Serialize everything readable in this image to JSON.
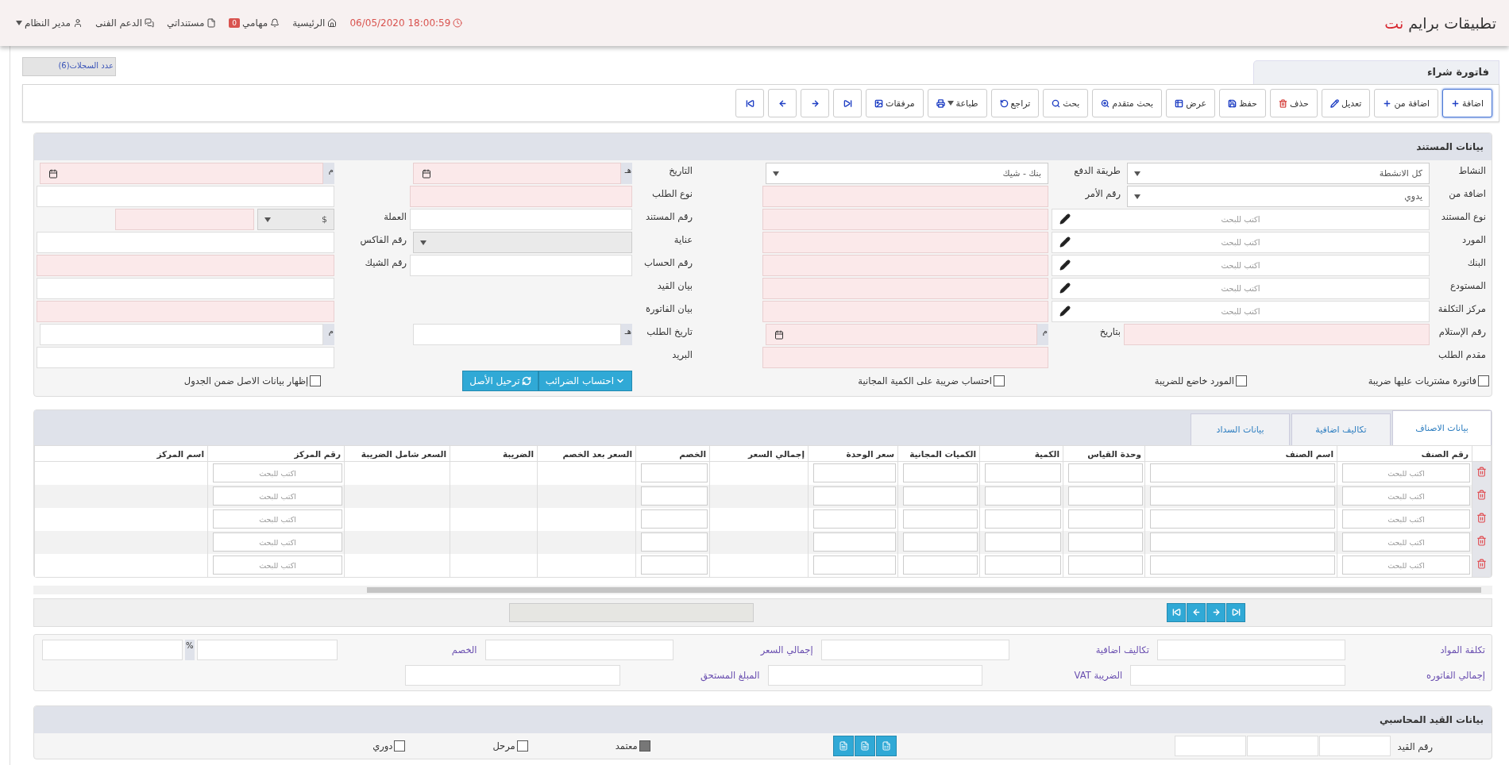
{
  "app": {
    "brand": "تطبيقات برايم",
    "brand_accent": "نت"
  },
  "top_nav": [
    {
      "kind": "clock",
      "label": "18:00:59 06/05/2020"
    },
    {
      "kind": "home",
      "label": "الرئيسية"
    },
    {
      "kind": "tasks",
      "label": "مهامي",
      "badge": "0"
    },
    {
      "kind": "docs",
      "label": "مستنداتي"
    },
    {
      "kind": "support",
      "label": "الدعم الفنى"
    },
    {
      "kind": "user",
      "label": "مدير النظام"
    }
  ],
  "page_title": "فاتورة شراء",
  "records_count": "عدد السجلات(6)",
  "toolbar": [
    {
      "kind": "add",
      "label": "اضافة",
      "selected": true
    },
    {
      "kind": "add_from",
      "label": "اضافة من",
      "selected": false
    },
    {
      "kind": "edit",
      "label": "تعديل",
      "selected": false
    },
    {
      "kind": "delete",
      "label": "حذف",
      "selected": false
    },
    {
      "kind": "save",
      "label": "حفظ",
      "selected": false
    },
    {
      "kind": "view",
      "label": "عرض",
      "selected": false
    },
    {
      "kind": "advanced_search",
      "label": "بحث متقدم",
      "selected": false
    },
    {
      "kind": "search",
      "label": "بحث",
      "selected": false
    },
    {
      "kind": "undo",
      "label": "تراجع",
      "selected": false
    },
    {
      "kind": "print",
      "label": "طباعة",
      "selected": false
    },
    {
      "kind": "attachments",
      "label": "مرفقات",
      "selected": false
    },
    {
      "kind": "last",
      "selected": false
    },
    {
      "kind": "next",
      "selected": false
    },
    {
      "kind": "prev",
      "selected": false
    },
    {
      "kind": "first",
      "selected": false
    }
  ],
  "document": {
    "title": "بيانات المستند",
    "right_rows": [
      {
        "cells": [
          {
            "kind": "label",
            "text": "النشاط"
          },
          {
            "kind": "select",
            "value": "كل الانشطة",
            "highlighted": false
          },
          {
            "kind": "label",
            "text": "طريقة الدفع"
          },
          {
            "kind": "select",
            "value": "بنك - شيك",
            "highlighted": false
          }
        ]
      },
      {
        "cells": [
          {
            "kind": "label",
            "text": "اضافة من"
          },
          {
            "kind": "select",
            "value": "يدوي",
            "highlighted": false
          },
          {
            "kind": "label",
            "text": "رقم الأمر"
          },
          {
            "kind": "input",
            "highlighted": true
          }
        ]
      },
      {
        "cells": [
          {
            "kind": "label",
            "text": "نوع المستند"
          },
          {
            "kind": "lookup",
            "placeholder": "اكتب للبحث",
            "highlighted": false
          },
          {
            "kind": "input",
            "highlighted": true
          }
        ]
      },
      {
        "cells": [
          {
            "kind": "label",
            "text": "المورد"
          },
          {
            "kind": "lookup",
            "placeholder": "اكتب للبحث",
            "highlighted": false
          },
          {
            "kind": "input",
            "highlighted": true
          }
        ]
      },
      {
        "cells": [
          {
            "kind": "label",
            "text": "البنك"
          },
          {
            "kind": "lookup",
            "placeholder": "اكتب للبحث",
            "highlighted": false
          },
          {
            "kind": "input",
            "highlighted": true
          }
        ]
      },
      {
        "cells": [
          {
            "kind": "label",
            "text": "المستودع"
          },
          {
            "kind": "lookup",
            "placeholder": "اكتب للبحث",
            "highlighted": false
          },
          {
            "kind": "input",
            "highlighted": true
          }
        ]
      },
      {
        "cells": [
          {
            "kind": "label",
            "text": "مركز التكلفة"
          },
          {
            "kind": "lookup",
            "placeholder": "اكتب للبحث",
            "highlighted": false
          },
          {
            "kind": "input",
            "highlighted": true
          }
        ]
      },
      {
        "cells": [
          {
            "kind": "label",
            "text": "رقم الإستلام"
          },
          {
            "kind": "input",
            "highlighted": true
          },
          {
            "kind": "label",
            "text": "بتاريخ"
          },
          {
            "kind": "date",
            "era": "م",
            "calendar": true,
            "highlighted": true
          }
        ]
      },
      {
        "cells": [
          {
            "kind": "label",
            "text": "مقدم الطلب"
          },
          {
            "kind": "input",
            "highlighted": true
          }
        ]
      }
    ],
    "checks": [
      {
        "label": "فاتورة مشتريات عليها ضريبة",
        "checked": false
      },
      {
        "label": "المورد خاضع للضريبة",
        "checked": false
      },
      {
        "label": "احتساب ضريبة على الكمية المجانية",
        "checked": false
      }
    ],
    "left_rows": [
      {
        "cells": [
          {
            "kind": "label",
            "text": "التاريخ"
          },
          {
            "kind": "date",
            "era": "هـ",
            "calendar": true,
            "highlighted": true
          },
          {
            "kind": "date",
            "era": "م",
            "calendar": true,
            "highlighted": true
          }
        ]
      },
      {
        "cells": [
          {
            "kind": "label",
            "text": "نوع الطلب"
          },
          {
            "kind": "input",
            "highlighted": true
          },
          {
            "kind": "input",
            "highlighted": false
          }
        ]
      },
      {
        "cells": [
          {
            "kind": "label",
            "text": "رقم المستند"
          },
          {
            "kind": "input",
            "highlighted": false
          },
          {
            "kind": "label",
            "text": "العملة"
          },
          {
            "kind": "currency",
            "value": "$",
            "highlighted": true
          }
        ]
      },
      {
        "cells": [
          {
            "kind": "label",
            "text": "عناية"
          },
          {
            "kind": "select",
            "highlighted": false
          },
          {
            "kind": "label",
            "text": "رقم الفاكس"
          },
          {
            "kind": "input",
            "highlighted": false
          }
        ]
      },
      {
        "cells": [
          {
            "kind": "label",
            "text": "رقم الحساب"
          },
          {
            "kind": "input",
            "highlighted": false
          },
          {
            "kind": "label",
            "text": "رقم الشيك"
          },
          {
            "kind": "input",
            "highlighted": true
          }
        ]
      },
      {
        "cells": [
          {
            "kind": "label",
            "text": "بيان القيد"
          },
          {
            "kind": "input",
            "highlighted": false
          }
        ]
      },
      {
        "cells": [
          {
            "kind": "label",
            "text": "بيان الفاتورة"
          },
          {
            "kind": "input",
            "highlighted": true
          }
        ]
      },
      {
        "cells": [
          {
            "kind": "label",
            "text": "تاريخ الطلب"
          },
          {
            "kind": "date",
            "era": "هـ",
            "calendar": false,
            "highlighted": false
          },
          {
            "kind": "date",
            "era": "م",
            "calendar": false,
            "highlighted": false
          }
        ]
      },
      {
        "cells": [
          {
            "kind": "label",
            "text": "البريد"
          },
          {
            "kind": "input",
            "highlighted": false
          }
        ]
      }
    ],
    "actions": [
      {
        "kind": "taxes",
        "label": "احتساب الضرائب"
      },
      {
        "kind": "post",
        "label": "ترحيل الأصل"
      }
    ],
    "show_asset": {
      "label": "إظهار بيانات الاصل ضمن الجدول",
      "checked": false
    }
  },
  "item_tabs": [
    {
      "label": "بيانات الاصناف",
      "selected": true
    },
    {
      "label": "تكاليف اضافية",
      "selected": false
    },
    {
      "label": "بيانات السداد",
      "selected": false
    }
  ],
  "table": {
    "columns": [
      {
        "label": "رقم الصنف",
        "kind": "lookup"
      },
      {
        "label": "اسم الصنف",
        "kind": "input"
      },
      {
        "label": "وحدة القياس",
        "kind": "input"
      },
      {
        "label": "الكمية",
        "kind": "input"
      },
      {
        "label": "الكميات المجانية",
        "kind": "input"
      },
      {
        "label": "سعر الوحدة",
        "kind": "input"
      },
      {
        "label": "إجمالي السعر",
        "kind": "plain"
      },
      {
        "label": "الخصم",
        "kind": "input"
      },
      {
        "label": "السعر بعد الخصم",
        "kind": "plain"
      },
      {
        "label": "الضريبة",
        "kind": "plain"
      },
      {
        "label": "السعر شامل الضريبة",
        "kind": "plain"
      },
      {
        "label": "رقم المركز",
        "kind": "lookup"
      },
      {
        "label": "اسم المركز",
        "kind": "plain"
      }
    ],
    "rows": [
      {
        "placeholders": [
          "اكتب للبحث",
          "اكتب للبحث"
        ]
      },
      {
        "placeholders": [
          "اكتب للبحث",
          "اكتب للبحث"
        ]
      },
      {
        "placeholders": [
          "اكتب للبحث",
          "اكتب للبحث"
        ]
      },
      {
        "placeholders": [
          "اكتب للبحث",
          "اكتب للبحث"
        ]
      },
      {
        "placeholders": [
          "اكتب للبحث",
          "اكتب للبحث"
        ]
      }
    ]
  },
  "pager": [
    {
      "kind": "first"
    },
    {
      "kind": "prev"
    },
    {
      "kind": "next"
    },
    {
      "kind": "last"
    }
  ],
  "summary": [
    [
      {
        "label": "تكلفة المواد"
      },
      {
        "label": "تكاليف اضافية"
      },
      {
        "label": "إجمالي السعر"
      },
      {
        "label": "الخصم",
        "percent": "%"
      }
    ],
    [
      {
        "label": "إجمالي الفاتوره"
      },
      {
        "label": "الضريبة VAT"
      },
      {
        "label": "المبلغ المستحق"
      }
    ]
  ],
  "accounting": {
    "title": "بيانات القيد المحاسبي",
    "number_label": "رقم القيد",
    "exports": [
      {
        "kind": "excel"
      },
      {
        "kind": "word"
      },
      {
        "kind": "pdf"
      }
    ],
    "flags": [
      {
        "label": "معتمد",
        "checked": true
      },
      {
        "label": "مرحل",
        "checked": false
      },
      {
        "label": "دوري",
        "checked": false
      }
    ]
  }
}
